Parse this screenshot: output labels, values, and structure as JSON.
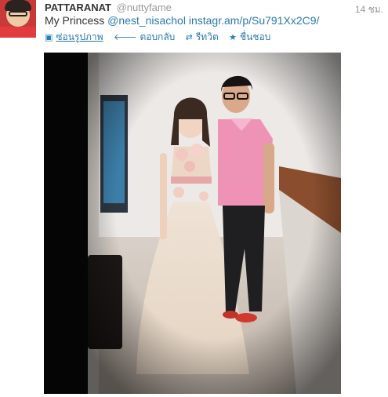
{
  "tweet": {
    "author_name": "PATTARANAT",
    "author_handle": "@nuttyfame",
    "timestamp": "14 ชม.",
    "text_prefix": "My Princess ",
    "mention": "@nest_nisachol",
    "link": "instagr.am/p/Su791Xx2C9/",
    "actions": {
      "hide_photo": "ซ่อนรูปภาพ",
      "reply": "ตอบกลับ",
      "retweet": "รีทวิต",
      "favorite": "ชื่นชอบ"
    }
  },
  "icons": {
    "avatar": "profile-photo",
    "hide_photo": "photo-icon",
    "reply": "reply-arrow-icon",
    "retweet": "retweet-icon",
    "favorite": "star-icon"
  },
  "colors": {
    "link": "#2a7ab0",
    "name": "#333333",
    "muted": "#999999"
  }
}
